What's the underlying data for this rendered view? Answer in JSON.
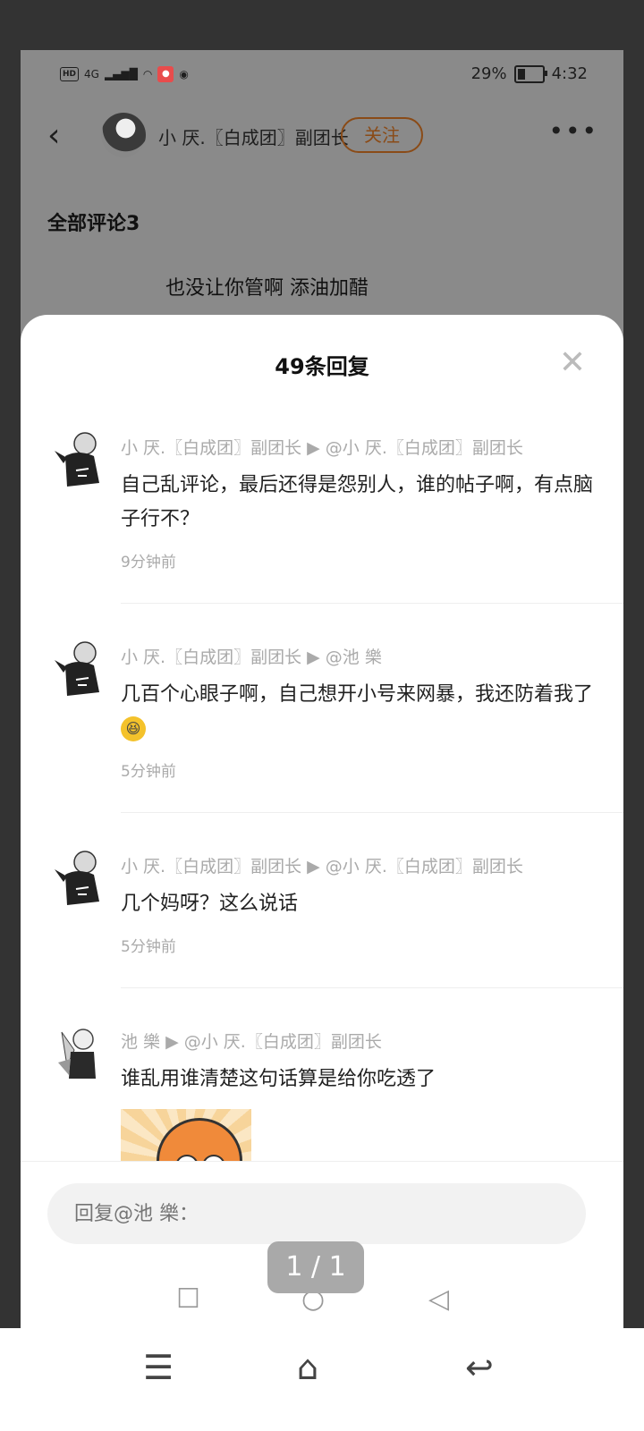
{
  "status_bar": {
    "hd": "HD",
    "network": "4G",
    "battery": "29%",
    "battery_level": 0.29,
    "time": "4:32"
  },
  "header": {
    "username": "小 厌.〖白成团〗副团长",
    "follow_label": "关注",
    "more_label": "•••"
  },
  "comments_header": "全部评论3",
  "background_comment": "也没让你管啊 添油加醋",
  "sheet": {
    "title": "49条回复",
    "replies": [
      {
        "author": "小 厌.〖白成团〗副团长",
        "target": "@小 厌.〖白成团〗副团长",
        "text": "自己乱评论，最后还得是怨别人，谁的帖子啊，有点脑子行不？",
        "time": "9分钟前"
      },
      {
        "author": "小 厌.〖白成团〗副团长",
        "target": "@池 樂",
        "text": "几百个心眼子啊，自己想开小号来网暴，我还防着我了",
        "time": "5分钟前"
      },
      {
        "author": "小 厌.〖白成团〗副团长",
        "target": "@小 厌.〖白成团〗副团长",
        "text": "几个妈呀？这么说话",
        "time": "5分钟前"
      },
      {
        "author": "池 樂",
        "target": "@小 厌.〖白成团〗副团长",
        "text": "谁乱用谁清楚这句话算是给你吃透了",
        "time": ""
      }
    ],
    "reply_placeholder": "回复@池 樂："
  },
  "page_indicator": "1 / 1",
  "icons": {
    "back": "chevron-left-icon",
    "close": "close-icon",
    "emoji": "laughing-emoji-icon"
  },
  "colors": {
    "follow": "#8a4b17",
    "dim_overlay": "#8a8a8a"
  }
}
